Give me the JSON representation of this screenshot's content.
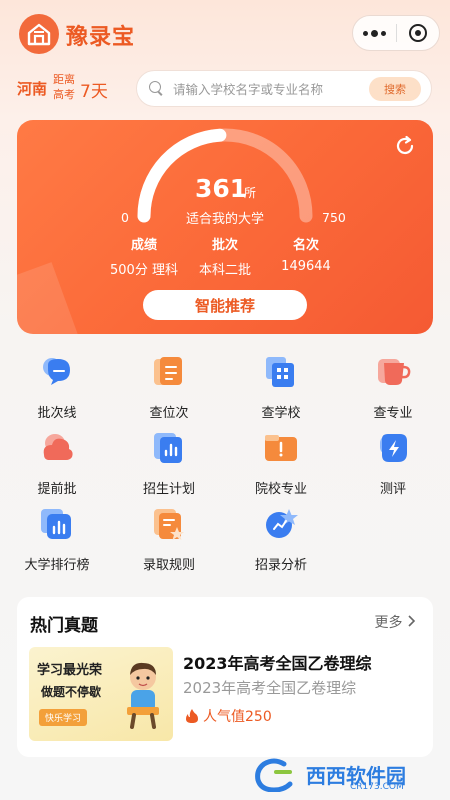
{
  "header": {
    "app_name": "豫录宝",
    "logo_icon": "house-icon",
    "capsule_icons": [
      "more-dots-icon",
      "close-ring-icon"
    ]
  },
  "location": {
    "province": "河南",
    "countdown_label_1": "距离",
    "countdown_label_2": "高考",
    "countdown_days": "7天"
  },
  "search": {
    "placeholder": "请输入学校名字或专业名称",
    "button_label": "搜索"
  },
  "score_card": {
    "count": "361",
    "count_unit": "所",
    "subtitle": "适合我的大学",
    "range_min": "0",
    "range_max": "750",
    "gauge_fraction": 0.48,
    "stats": [
      {
        "header": "成绩",
        "value": "500分 理科"
      },
      {
        "header": "批次",
        "value": "本科二批"
      },
      {
        "header": "名次",
        "value": "149644"
      }
    ],
    "recommend_label": "智能推荐",
    "refresh_icon": "refresh-icon"
  },
  "grid": [
    {
      "label": "批次线",
      "icon": "chat-bubble-icon",
      "color": "#3a7df0"
    },
    {
      "label": "查位次",
      "icon": "document-icon",
      "color": "#f58a3c"
    },
    {
      "label": "查学校",
      "icon": "building-icon",
      "color": "#3a7df0"
    },
    {
      "label": "查专业",
      "icon": "cup-icon",
      "color": "#f06a5a"
    },
    {
      "label": "提前批",
      "icon": "cloud-icon",
      "color": "#f06a5a"
    },
    {
      "label": "招生计划",
      "icon": "bar-chart-doc-icon",
      "color": "#3a7df0"
    },
    {
      "label": "院校专业",
      "icon": "folder-alert-icon",
      "color": "#f58a3c"
    },
    {
      "label": "测评",
      "icon": "lightning-icon",
      "color": "#3a7df0"
    },
    {
      "label": "大学排行榜",
      "icon": "ranking-chart-icon",
      "color": "#3a7df0"
    },
    {
      "label": "录取规则",
      "icon": "rules-star-icon",
      "color": "#f58a3c"
    },
    {
      "label": "招录分析",
      "icon": "analysis-star-icon",
      "color": "#3a7df0"
    }
  ],
  "hot": {
    "title": "热门真题",
    "more_label": "更多",
    "item": {
      "thumb_line1": "学习最光荣",
      "thumb_line2": "做题不停歇",
      "thumb_tag": "快乐学习",
      "title": "2023年高考全国乙卷理综",
      "subtitle": "2023年高考全国乙卷理综",
      "popularity": "人气值250",
      "fire_icon": "fire-icon"
    }
  },
  "watermark": {
    "main": "西西软件园",
    "sub": "CR173.COM"
  }
}
